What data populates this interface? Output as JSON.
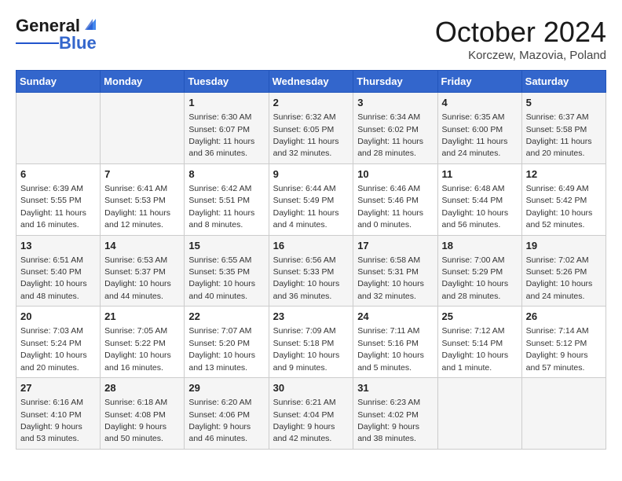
{
  "header": {
    "logo_general": "General",
    "logo_blue": "Blue",
    "month": "October 2024",
    "location": "Korczew, Mazovia, Poland"
  },
  "days_of_week": [
    "Sunday",
    "Monday",
    "Tuesday",
    "Wednesday",
    "Thursday",
    "Friday",
    "Saturday"
  ],
  "weeks": [
    [
      {
        "day": "",
        "empty": true
      },
      {
        "day": "",
        "empty": true
      },
      {
        "day": "1",
        "sunrise": "Sunrise: 6:30 AM",
        "sunset": "Sunset: 6:07 PM",
        "daylight": "Daylight: 11 hours and 36 minutes."
      },
      {
        "day": "2",
        "sunrise": "Sunrise: 6:32 AM",
        "sunset": "Sunset: 6:05 PM",
        "daylight": "Daylight: 11 hours and 32 minutes."
      },
      {
        "day": "3",
        "sunrise": "Sunrise: 6:34 AM",
        "sunset": "Sunset: 6:02 PM",
        "daylight": "Daylight: 11 hours and 28 minutes."
      },
      {
        "day": "4",
        "sunrise": "Sunrise: 6:35 AM",
        "sunset": "Sunset: 6:00 PM",
        "daylight": "Daylight: 11 hours and 24 minutes."
      },
      {
        "day": "5",
        "sunrise": "Sunrise: 6:37 AM",
        "sunset": "Sunset: 5:58 PM",
        "daylight": "Daylight: 11 hours and 20 minutes."
      }
    ],
    [
      {
        "day": "6",
        "sunrise": "Sunrise: 6:39 AM",
        "sunset": "Sunset: 5:55 PM",
        "daylight": "Daylight: 11 hours and 16 minutes."
      },
      {
        "day": "7",
        "sunrise": "Sunrise: 6:41 AM",
        "sunset": "Sunset: 5:53 PM",
        "daylight": "Daylight: 11 hours and 12 minutes."
      },
      {
        "day": "8",
        "sunrise": "Sunrise: 6:42 AM",
        "sunset": "Sunset: 5:51 PM",
        "daylight": "Daylight: 11 hours and 8 minutes."
      },
      {
        "day": "9",
        "sunrise": "Sunrise: 6:44 AM",
        "sunset": "Sunset: 5:49 PM",
        "daylight": "Daylight: 11 hours and 4 minutes."
      },
      {
        "day": "10",
        "sunrise": "Sunrise: 6:46 AM",
        "sunset": "Sunset: 5:46 PM",
        "daylight": "Daylight: 11 hours and 0 minutes."
      },
      {
        "day": "11",
        "sunrise": "Sunrise: 6:48 AM",
        "sunset": "Sunset: 5:44 PM",
        "daylight": "Daylight: 10 hours and 56 minutes."
      },
      {
        "day": "12",
        "sunrise": "Sunrise: 6:49 AM",
        "sunset": "Sunset: 5:42 PM",
        "daylight": "Daylight: 10 hours and 52 minutes."
      }
    ],
    [
      {
        "day": "13",
        "sunrise": "Sunrise: 6:51 AM",
        "sunset": "Sunset: 5:40 PM",
        "daylight": "Daylight: 10 hours and 48 minutes."
      },
      {
        "day": "14",
        "sunrise": "Sunrise: 6:53 AM",
        "sunset": "Sunset: 5:37 PM",
        "daylight": "Daylight: 10 hours and 44 minutes."
      },
      {
        "day": "15",
        "sunrise": "Sunrise: 6:55 AM",
        "sunset": "Sunset: 5:35 PM",
        "daylight": "Daylight: 10 hours and 40 minutes."
      },
      {
        "day": "16",
        "sunrise": "Sunrise: 6:56 AM",
        "sunset": "Sunset: 5:33 PM",
        "daylight": "Daylight: 10 hours and 36 minutes."
      },
      {
        "day": "17",
        "sunrise": "Sunrise: 6:58 AM",
        "sunset": "Sunset: 5:31 PM",
        "daylight": "Daylight: 10 hours and 32 minutes."
      },
      {
        "day": "18",
        "sunrise": "Sunrise: 7:00 AM",
        "sunset": "Sunset: 5:29 PM",
        "daylight": "Daylight: 10 hours and 28 minutes."
      },
      {
        "day": "19",
        "sunrise": "Sunrise: 7:02 AM",
        "sunset": "Sunset: 5:26 PM",
        "daylight": "Daylight: 10 hours and 24 minutes."
      }
    ],
    [
      {
        "day": "20",
        "sunrise": "Sunrise: 7:03 AM",
        "sunset": "Sunset: 5:24 PM",
        "daylight": "Daylight: 10 hours and 20 minutes."
      },
      {
        "day": "21",
        "sunrise": "Sunrise: 7:05 AM",
        "sunset": "Sunset: 5:22 PM",
        "daylight": "Daylight: 10 hours and 16 minutes."
      },
      {
        "day": "22",
        "sunrise": "Sunrise: 7:07 AM",
        "sunset": "Sunset: 5:20 PM",
        "daylight": "Daylight: 10 hours and 13 minutes."
      },
      {
        "day": "23",
        "sunrise": "Sunrise: 7:09 AM",
        "sunset": "Sunset: 5:18 PM",
        "daylight": "Daylight: 10 hours and 9 minutes."
      },
      {
        "day": "24",
        "sunrise": "Sunrise: 7:11 AM",
        "sunset": "Sunset: 5:16 PM",
        "daylight": "Daylight: 10 hours and 5 minutes."
      },
      {
        "day": "25",
        "sunrise": "Sunrise: 7:12 AM",
        "sunset": "Sunset: 5:14 PM",
        "daylight": "Daylight: 10 hours and 1 minute."
      },
      {
        "day": "26",
        "sunrise": "Sunrise: 7:14 AM",
        "sunset": "Sunset: 5:12 PM",
        "daylight": "Daylight: 9 hours and 57 minutes."
      }
    ],
    [
      {
        "day": "27",
        "sunrise": "Sunrise: 6:16 AM",
        "sunset": "Sunset: 4:10 PM",
        "daylight": "Daylight: 9 hours and 53 minutes."
      },
      {
        "day": "28",
        "sunrise": "Sunrise: 6:18 AM",
        "sunset": "Sunset: 4:08 PM",
        "daylight": "Daylight: 9 hours and 50 minutes."
      },
      {
        "day": "29",
        "sunrise": "Sunrise: 6:20 AM",
        "sunset": "Sunset: 4:06 PM",
        "daylight": "Daylight: 9 hours and 46 minutes."
      },
      {
        "day": "30",
        "sunrise": "Sunrise: 6:21 AM",
        "sunset": "Sunset: 4:04 PM",
        "daylight": "Daylight: 9 hours and 42 minutes."
      },
      {
        "day": "31",
        "sunrise": "Sunrise: 6:23 AM",
        "sunset": "Sunset: 4:02 PM",
        "daylight": "Daylight: 9 hours and 38 minutes."
      },
      {
        "day": "",
        "empty": true
      },
      {
        "day": "",
        "empty": true
      }
    ]
  ]
}
